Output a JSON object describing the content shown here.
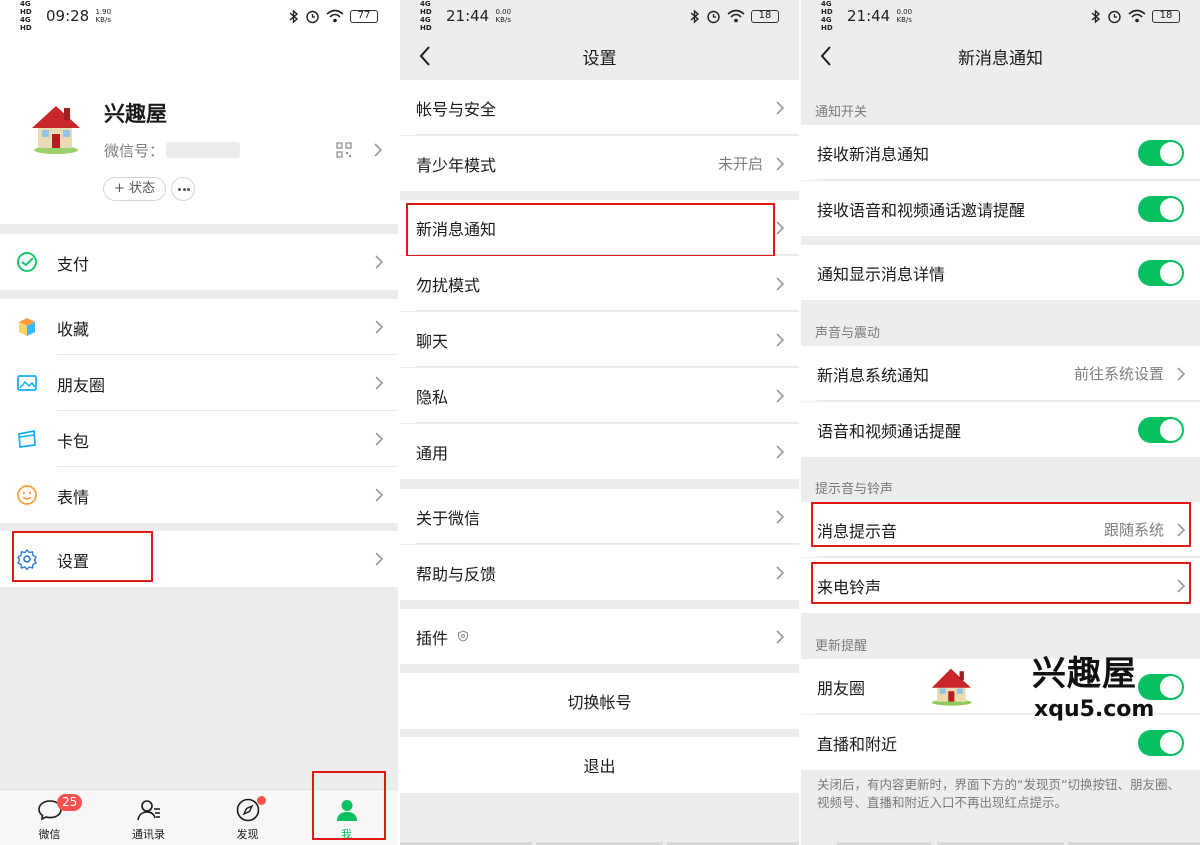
{
  "panel1": {
    "status": {
      "signal": "4G HD 4G HD",
      "time": "09:28",
      "speed_value": "1.90",
      "speed_unit": "KB/s",
      "battery": "77"
    },
    "profile": {
      "name": "兴趣屋",
      "wechat_id_label": "微信号：",
      "status_label": "+ 状态"
    },
    "menu": [
      {
        "label": "支付",
        "icon": "payment-icon"
      },
      {
        "label": "收藏",
        "icon": "favorites-cube-icon"
      },
      {
        "label": "朋友圈",
        "icon": "moments-image-icon"
      },
      {
        "label": "卡包",
        "icon": "card-wallet-icon"
      },
      {
        "label": "表情",
        "icon": "emoji-smile-icon"
      },
      {
        "label": "设置",
        "icon": "settings-gear-icon"
      }
    ],
    "tabs": [
      {
        "label": "微信",
        "badge": "25"
      },
      {
        "label": "通讯录"
      },
      {
        "label": "发现"
      },
      {
        "label": "我"
      }
    ],
    "colors": {
      "accent": "#07c160",
      "badge": "#fa5151",
      "highlight_box": "#e01818"
    }
  },
  "panel2": {
    "status": {
      "signal": "4G HD 4G HD",
      "time": "21:44",
      "speed_value": "0.00",
      "speed_unit": "KB/s",
      "battery": "18"
    },
    "title": "设置",
    "items": [
      {
        "label": "帐号与安全"
      },
      {
        "label": "青少年模式",
        "value": "未开启"
      },
      {
        "label": "新消息通知"
      },
      {
        "label": "勿扰模式"
      },
      {
        "label": "聊天"
      },
      {
        "label": "隐私"
      },
      {
        "label": "通用"
      },
      {
        "label": "关于微信"
      },
      {
        "label": "帮助与反馈"
      },
      {
        "label": "插件"
      }
    ],
    "switch_account": "切换帐号",
    "logout": "退出"
  },
  "panel3": {
    "status": {
      "signal": "4G HD 4G HD",
      "time": "21:44",
      "speed_value": "0.00",
      "speed_unit": "KB/s",
      "battery": "18"
    },
    "title": "新消息通知",
    "sections": {
      "notify": "通知开关",
      "sound": "声音与震动",
      "tone": "提示音与铃声",
      "update": "更新提醒"
    },
    "rows": {
      "receive": "接收新消息通知",
      "receive_call": "接收语音和视频通话邀请提醒",
      "show_detail": "通知显示消息详情",
      "system_notify": "新消息系统通知",
      "system_notify_value": "前往系统设置",
      "call_remind": "语音和视频通话提醒",
      "msg_tone": "消息提示音",
      "msg_tone_value": "跟随系统",
      "ringtone": "来电铃声",
      "moments": "朋友圈",
      "live_nearby": "直播和附近"
    },
    "footnote": "关闭后，有内容更新时，界面下方的“发现页”切换按钮、朋友圈、视频号、直播和附近入口不再出现红点提示。",
    "watermark": {
      "title": "兴趣屋",
      "url": "xqu5.com"
    }
  }
}
